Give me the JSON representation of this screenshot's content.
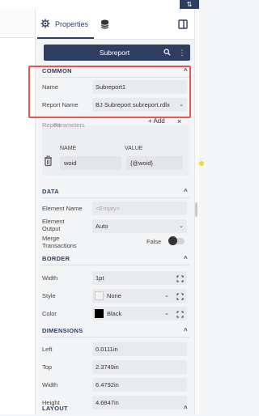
{
  "tabs": {
    "properties_label": "Properties"
  },
  "selector": {
    "label": "Subreport"
  },
  "common": {
    "title": "COMMON",
    "name_label": "Name",
    "name_value": "Subreport1",
    "report_name_label": "Report Name",
    "report_name_value": "BJ Subreport subreport.rdlx",
    "params_label": "Parameters",
    "add_label": "Add",
    "col_name": "NAME",
    "col_value": "VALUE",
    "param_name": "woid",
    "param_value": "{@woid}"
  },
  "data": {
    "title": "DATA",
    "element_name_label": "Element Name",
    "element_name_placeholder": "<Empty>",
    "element_output_label": "Element Output",
    "element_output_value": "Auto",
    "merge_label": "Merge Transactions",
    "merge_value": "False"
  },
  "border": {
    "title": "BORDER",
    "width_label": "Width",
    "width_value": "1pt",
    "style_label": "Style",
    "style_value": "None",
    "color_label": "Color",
    "color_value": "Black",
    "color_hex": "#000000"
  },
  "dimensions": {
    "title": "DIMENSIONS",
    "left_label": "Left",
    "left_value": "0.0111in",
    "top_label": "Top",
    "top_value": "2.3749in",
    "width_label": "Width",
    "width_value": "6.4792in",
    "height_label": "Height",
    "height_value": "4.6847in"
  },
  "layout": {
    "title": "LAYOUT"
  },
  "colors": {
    "accent": "#2e3e60",
    "highlight": "#e8554f",
    "param_dot": "#f5d633"
  }
}
